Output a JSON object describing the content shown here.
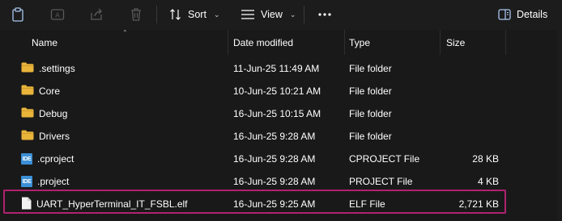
{
  "toolbar": {
    "sort_label": "Sort",
    "view_label": "View",
    "details_label": "Details"
  },
  "columns": {
    "name": "Name",
    "date": "Date modified",
    "type": "Type",
    "size": "Size"
  },
  "files": [
    {
      "name": ".settings",
      "date": "11-Jun-25 11:49 AM",
      "type": "File folder",
      "size": "",
      "icon": "folder-icon"
    },
    {
      "name": "Core",
      "date": "10-Jun-25 10:21 AM",
      "type": "File folder",
      "size": "",
      "icon": "folder-icon"
    },
    {
      "name": "Debug",
      "date": "16-Jun-25 10:15 AM",
      "type": "File folder",
      "size": "",
      "icon": "folder-icon"
    },
    {
      "name": "Drivers",
      "date": "16-Jun-25 9:28 AM",
      "type": "File folder",
      "size": "",
      "icon": "folder-icon"
    },
    {
      "name": ".cproject",
      "date": "16-Jun-25 9:28 AM",
      "type": "CPROJECT File",
      "size": "28 KB",
      "icon": "ide-icon"
    },
    {
      "name": ".project",
      "date": "16-Jun-25 9:28 AM",
      "type": "PROJECT File",
      "size": "4 KB",
      "icon": "ide-icon"
    },
    {
      "name": "UART_HyperTerminal_IT_FSBL.elf",
      "date": "16-Jun-25 9:25 AM",
      "type": "ELF File",
      "size": "2,721 KB",
      "icon": "file-icon"
    }
  ],
  "ide_badge": "IDE",
  "highlight_color": "#b0226e",
  "folder_color": "#e8b43a"
}
